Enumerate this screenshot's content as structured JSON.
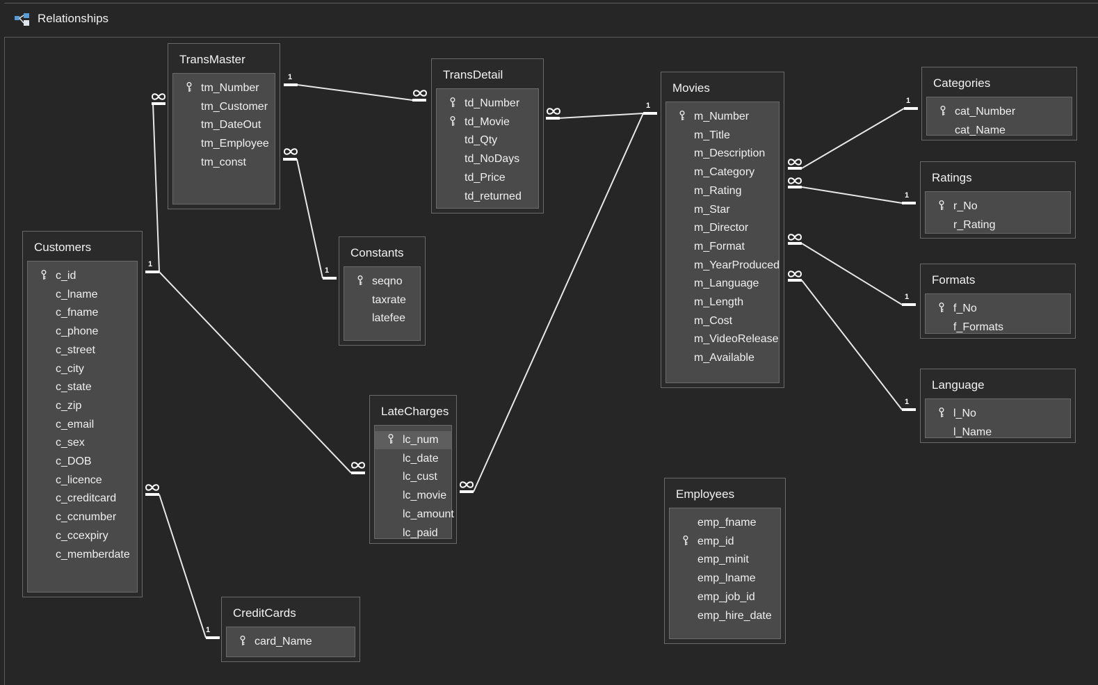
{
  "window": {
    "title": "Relationships"
  },
  "tables": {
    "transmaster": {
      "name": "TransMaster",
      "fields": [
        {
          "name": "tm_Number",
          "key": true
        },
        {
          "name": "tm_Customer"
        },
        {
          "name": "tm_DateOut"
        },
        {
          "name": "tm_Employee"
        },
        {
          "name": "tm_const"
        }
      ]
    },
    "transdetail": {
      "name": "TransDetail",
      "fields": [
        {
          "name": "td_Number",
          "key": true
        },
        {
          "name": "td_Movie",
          "key": true
        },
        {
          "name": "td_Qty"
        },
        {
          "name": "td_NoDays"
        },
        {
          "name": "td_Price"
        },
        {
          "name": "td_returned"
        }
      ]
    },
    "movies": {
      "name": "Movies",
      "fields": [
        {
          "name": "m_Number",
          "key": true
        },
        {
          "name": "m_Title"
        },
        {
          "name": "m_Description"
        },
        {
          "name": "m_Category"
        },
        {
          "name": "m_Rating"
        },
        {
          "name": "m_Star"
        },
        {
          "name": "m_Director"
        },
        {
          "name": "m_Format"
        },
        {
          "name": "m_YearProduced"
        },
        {
          "name": "m_Language"
        },
        {
          "name": "m_Length"
        },
        {
          "name": "m_Cost"
        },
        {
          "name": "m_VideoRelease"
        },
        {
          "name": "m_Available"
        }
      ]
    },
    "categories": {
      "name": "Categories",
      "fields": [
        {
          "name": "cat_Number",
          "key": true
        },
        {
          "name": "cat_Name"
        }
      ]
    },
    "ratings": {
      "name": "Ratings",
      "fields": [
        {
          "name": "r_No",
          "key": true
        },
        {
          "name": "r_Rating"
        }
      ]
    },
    "formats": {
      "name": "Formats",
      "fields": [
        {
          "name": "f_No",
          "key": true
        },
        {
          "name": "f_Formats"
        }
      ]
    },
    "language": {
      "name": "Language",
      "fields": [
        {
          "name": "l_No",
          "key": true
        },
        {
          "name": "l_Name"
        }
      ]
    },
    "customers": {
      "name": "Customers",
      "fields": [
        {
          "name": "c_id",
          "key": true
        },
        {
          "name": "c_lname"
        },
        {
          "name": "c_fname"
        },
        {
          "name": "c_phone"
        },
        {
          "name": "c_street"
        },
        {
          "name": "c_city"
        },
        {
          "name": "c_state"
        },
        {
          "name": "c_zip"
        },
        {
          "name": "c_email"
        },
        {
          "name": "c_sex"
        },
        {
          "name": "c_DOB"
        },
        {
          "name": "c_licence"
        },
        {
          "name": "c_creditcard"
        },
        {
          "name": "c_ccnumber"
        },
        {
          "name": "c_ccexpiry"
        },
        {
          "name": "c_memberdate"
        }
      ]
    },
    "constants": {
      "name": "Constants",
      "fields": [
        {
          "name": "seqno",
          "key": true
        },
        {
          "name": "taxrate"
        },
        {
          "name": "latefee"
        }
      ]
    },
    "latecharges": {
      "name": "LateCharges",
      "fields": [
        {
          "name": "lc_num",
          "key": true,
          "selected": true
        },
        {
          "name": "lc_date"
        },
        {
          "name": "lc_cust"
        },
        {
          "name": "lc_movie"
        },
        {
          "name": "lc_amount"
        },
        {
          "name": "lc_paid"
        }
      ]
    },
    "employees": {
      "name": "Employees",
      "fields": [
        {
          "name": "emp_fname"
        },
        {
          "name": "emp_id",
          "key": true
        },
        {
          "name": "emp_minit"
        },
        {
          "name": "emp_lname"
        },
        {
          "name": "emp_job_id"
        },
        {
          "name": "emp_hire_date"
        }
      ]
    },
    "creditcards": {
      "name": "CreditCards",
      "fields": [
        {
          "name": "card_Name",
          "key": true
        }
      ]
    }
  },
  "relationships": {
    "one_label": "1",
    "one_label_customers": "1",
    "many_symbol": "infinity-icon"
  }
}
